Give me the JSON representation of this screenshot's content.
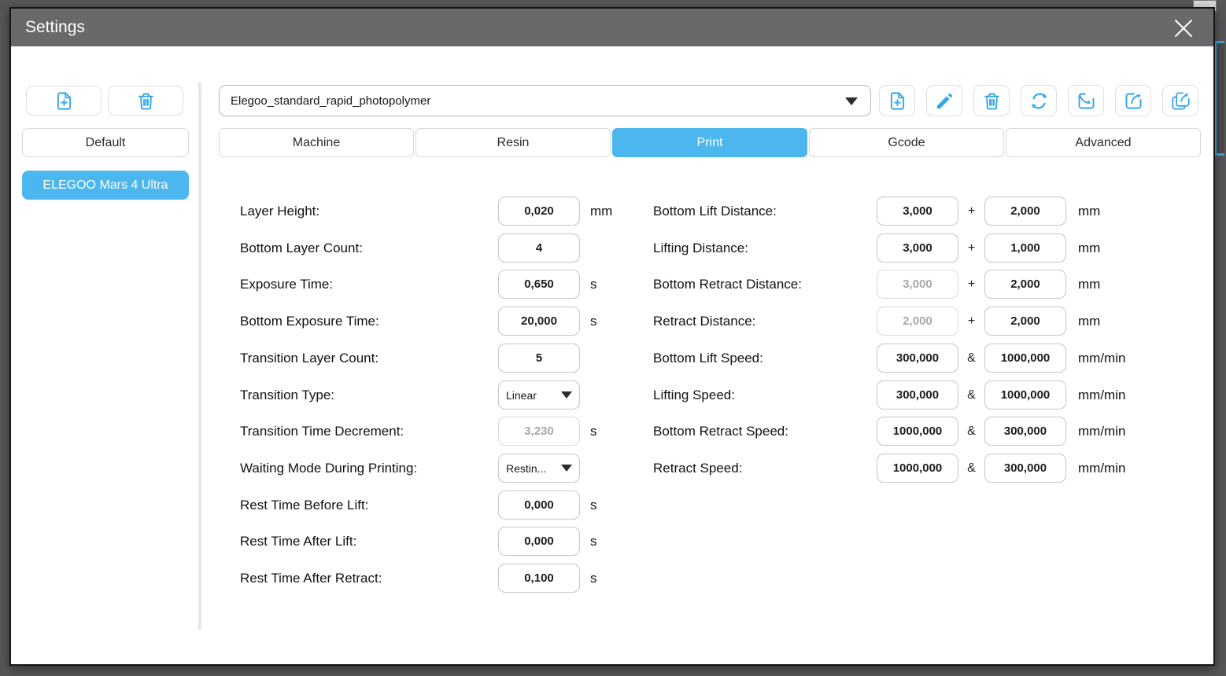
{
  "window": {
    "title": "Settings"
  },
  "colors": {
    "accent": "#35a7e6",
    "active_blue": "#4bb7ee",
    "titlebar": "#69696c"
  },
  "sidebar": {
    "buttons": [
      {
        "name": "add-printer",
        "icon": "file-plus-icon"
      },
      {
        "name": "delete-printer",
        "icon": "trash-icon"
      }
    ],
    "profiles": [
      {
        "label": "Default",
        "active": false
      },
      {
        "label": "ELEGOO Mars 4 Ultra",
        "active": true
      }
    ]
  },
  "profile_bar": {
    "selected_profile": "Elegoo_standard_rapid_photopolymer",
    "actions": [
      {
        "name": "add-profile",
        "icon": "file-plus-icon"
      },
      {
        "name": "rename-profile",
        "icon": "pencil-icon"
      },
      {
        "name": "delete-profile",
        "icon": "trash-icon"
      },
      {
        "name": "reset-profile",
        "icon": "refresh-icon"
      },
      {
        "name": "import-profile",
        "icon": "import-icon"
      },
      {
        "name": "export-profile",
        "icon": "export-icon"
      },
      {
        "name": "export-all-profiles",
        "icon": "export-all-icon"
      }
    ]
  },
  "tabs": [
    {
      "label": "Machine",
      "active": false
    },
    {
      "label": "Resin",
      "active": false
    },
    {
      "label": "Print",
      "active": true
    },
    {
      "label": "Gcode",
      "active": false
    },
    {
      "label": "Advanced",
      "active": false
    }
  ],
  "form": {
    "left_fields": [
      {
        "label": "Layer Height:",
        "value": "0,020",
        "unit": "mm",
        "control": "input",
        "disabled": false
      },
      {
        "label": "Bottom Layer Count:",
        "value": "4",
        "unit": "",
        "control": "input",
        "disabled": false
      },
      {
        "label": "Exposure Time:",
        "value": "0,650",
        "unit": "s",
        "control": "input",
        "disabled": false
      },
      {
        "label": "Bottom Exposure Time:",
        "value": "20,000",
        "unit": "s",
        "control": "input",
        "disabled": false
      },
      {
        "label": "Transition Layer Count:",
        "value": "5",
        "unit": "",
        "control": "input",
        "disabled": false
      },
      {
        "label": "Transition Type:",
        "value": "Linear",
        "unit": "",
        "control": "dropdown",
        "disabled": false
      },
      {
        "label": "Transition Time Decrement:",
        "value": "3,230",
        "unit": "s",
        "control": "input",
        "disabled": true
      },
      {
        "label": "Waiting Mode During Printing:",
        "value": "Restin...",
        "unit": "",
        "control": "dropdown",
        "disabled": false
      },
      {
        "label": "Rest Time Before Lift:",
        "value": "0,000",
        "unit": "s",
        "control": "input",
        "disabled": false
      },
      {
        "label": "Rest Time After Lift:",
        "value": "0,000",
        "unit": "s",
        "control": "input",
        "disabled": false
      },
      {
        "label": "Rest Time After Retract:",
        "value": "0,100",
        "unit": "s",
        "control": "input",
        "disabled": false
      }
    ],
    "right_fields": [
      {
        "label": "Bottom Lift Distance:",
        "value1": "3,000",
        "separator": "+",
        "value2": "2,000",
        "unit": "mm",
        "disabled1": false,
        "disabled2": false
      },
      {
        "label": "Lifting Distance:",
        "value1": "3,000",
        "separator": "+",
        "value2": "1,000",
        "unit": "mm",
        "disabled1": false,
        "disabled2": false
      },
      {
        "label": "Bottom Retract Distance:",
        "value1": "3,000",
        "separator": "+",
        "value2": "2,000",
        "unit": "mm",
        "disabled1": true,
        "disabled2": false
      },
      {
        "label": "Retract Distance:",
        "value1": "2,000",
        "separator": "+",
        "value2": "2,000",
        "unit": "mm",
        "disabled1": true,
        "disabled2": false
      },
      {
        "label": "Bottom Lift Speed:",
        "value1": "300,000",
        "separator": "&",
        "value2": "1000,000",
        "unit": "mm/min",
        "disabled1": false,
        "disabled2": false
      },
      {
        "label": "Lifting Speed:",
        "value1": "300,000",
        "separator": "&",
        "value2": "1000,000",
        "unit": "mm/min",
        "disabled1": false,
        "disabled2": false
      },
      {
        "label": "Bottom Retract Speed:",
        "value1": "1000,000",
        "separator": "&",
        "value2": "300,000",
        "unit": "mm/min",
        "disabled1": false,
        "disabled2": false
      },
      {
        "label": "Retract Speed:",
        "value1": "1000,000",
        "separator": "&",
        "value2": "300,000",
        "unit": "mm/min",
        "disabled1": false,
        "disabled2": false
      }
    ]
  }
}
